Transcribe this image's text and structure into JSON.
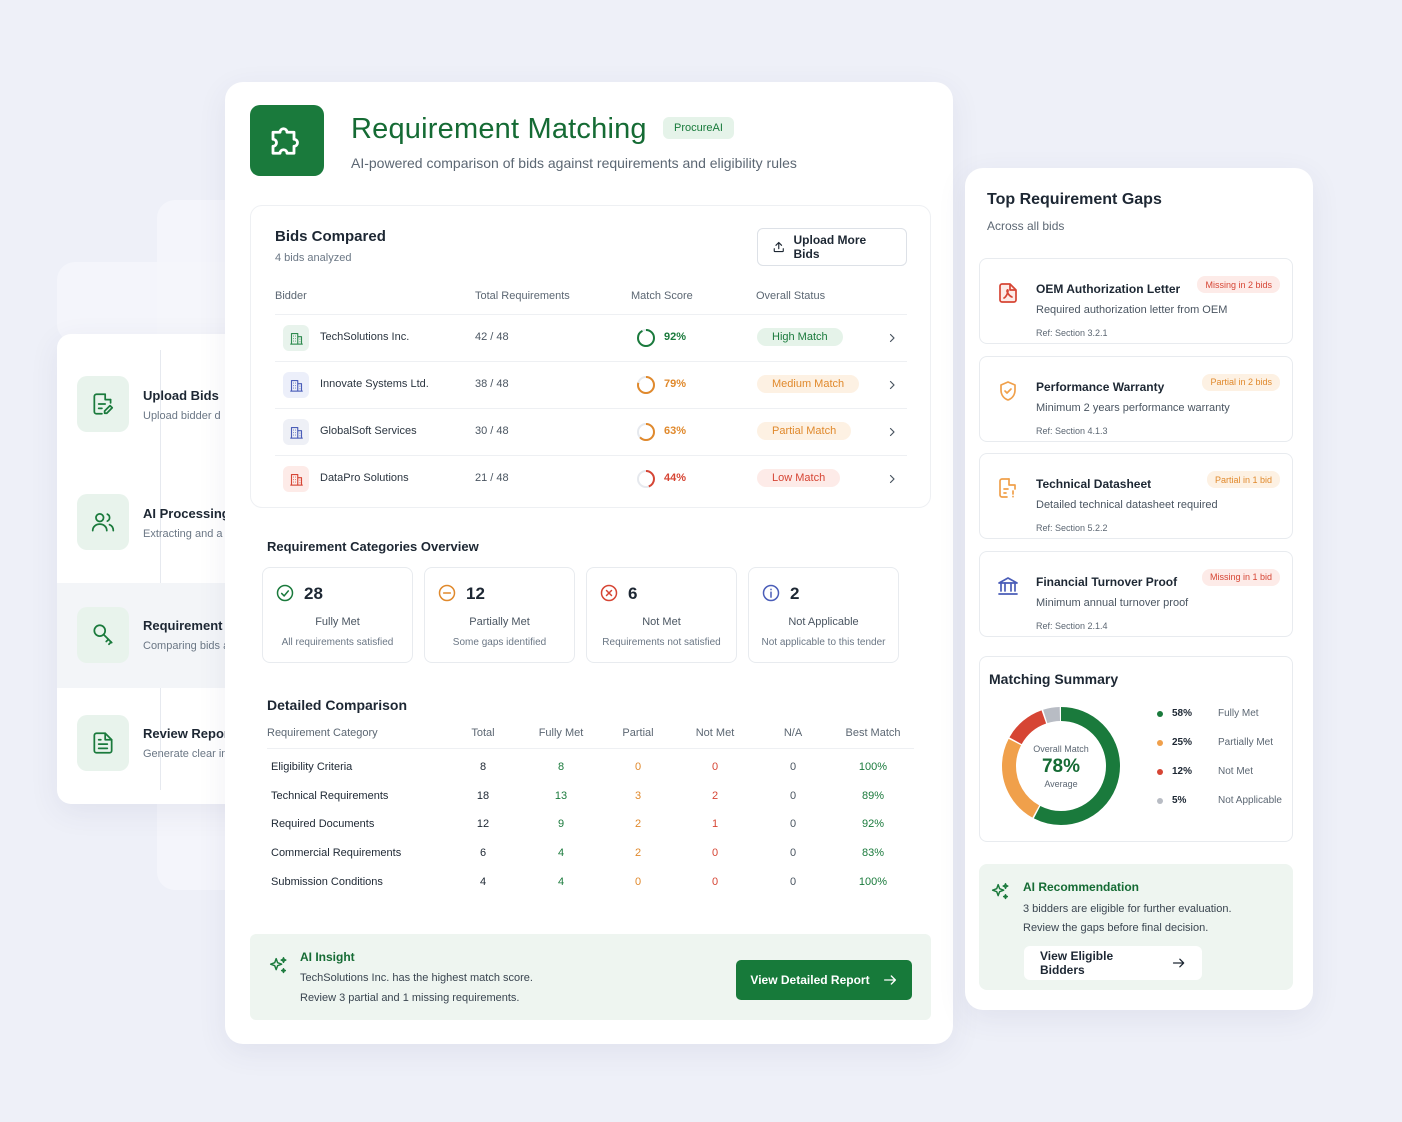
{
  "header": {
    "title": "Requirement Matching",
    "badge": "ProcureAI",
    "subtitle": "AI-powered comparison of bids against requirements and eligibility rules"
  },
  "workflow": {
    "steps": [
      {
        "title": "Upload Bids",
        "sub": "Upload bidder d",
        "icon": "document-edit-icon"
      },
      {
        "title": "AI Processing",
        "sub": "Extracting and a",
        "icon": "users-icon"
      },
      {
        "title": "Requirement M",
        "sub": "Comparing bids a",
        "icon": "match-search-icon"
      },
      {
        "title": "Review Report",
        "sub": "Generate clear in",
        "icon": "report-icon"
      }
    ]
  },
  "bids": {
    "title": "Bids Compared",
    "sub": "4 bids analyzed",
    "upload_label": "Upload More Bids",
    "columns": [
      "Bidder",
      "Total Requirements",
      "Match Score",
      "Overall Status"
    ],
    "rows": [
      {
        "name": "TechSolutions Inc.",
        "total": "42 / 48",
        "score": "92%",
        "score_value": 92,
        "status": "High Match",
        "color": "#1a7a3c",
        "bg": "#e5f3e9",
        "icon_color": "#2e8b4e",
        "icon_bg": "#e8f3ec"
      },
      {
        "name": "Innovate Systems Ltd.",
        "total": "38 / 48",
        "score": "79%",
        "score_value": 79,
        "status": "Medium Match",
        "color": "#e0892c",
        "bg": "#fdf1e3",
        "icon_color": "#4a5db8",
        "icon_bg": "#eceffa"
      },
      {
        "name": "GlobalSoft Services",
        "total": "30 / 48",
        "score": "63%",
        "score_value": 63,
        "status": "Partial Match",
        "color": "#e0892c",
        "bg": "#fdf1e3",
        "icon_color": "#4a5db8",
        "icon_bg": "#eef0f6"
      },
      {
        "name": "DataPro Solutions",
        "total": "21 / 48",
        "score": "44%",
        "score_value": 44,
        "status": "Low Match",
        "color": "#d64534",
        "bg": "#fdebe8",
        "icon_color": "#d64534",
        "icon_bg": "#fdebe8"
      }
    ]
  },
  "categories": {
    "title": "Requirement Categories Overview",
    "items": [
      {
        "count": "28",
        "label": "Fully Met",
        "desc": "All requirements satisfied",
        "icon": "check-circle-icon",
        "color": "#1a7a3c"
      },
      {
        "count": "12",
        "label": "Partially Met",
        "desc": "Some gaps identified",
        "icon": "minus-circle-icon",
        "color": "#e0892c"
      },
      {
        "count": "6",
        "label": "Not Met",
        "desc": "Requirements not satisfied",
        "icon": "x-circle-icon",
        "color": "#d64534"
      },
      {
        "count": "2",
        "label": "Not Applicable",
        "desc": "Not applicable to this tender",
        "icon": "info-circle-icon",
        "color": "#4a5db8"
      }
    ]
  },
  "detailed": {
    "title": "Detailed Comparison",
    "columns": [
      "Requirement Category",
      "Total",
      "Fully Met",
      "Partial",
      "Not Met",
      "N/A",
      "Best Match"
    ],
    "rows": [
      {
        "name": "Eligibility Criteria",
        "total": "8",
        "full": "8",
        "partial": "0",
        "not": "0",
        "na": "0",
        "best": "100%"
      },
      {
        "name": "Technical Requirements",
        "total": "18",
        "full": "13",
        "partial": "3",
        "not": "2",
        "na": "0",
        "best": "89%"
      },
      {
        "name": "Required Documents",
        "total": "12",
        "full": "9",
        "partial": "2",
        "not": "1",
        "na": "0",
        "best": "92%"
      },
      {
        "name": "Commercial Requirements",
        "total": "6",
        "full": "4",
        "partial": "2",
        "not": "0",
        "na": "0",
        "best": "83%"
      },
      {
        "name": "Submission Conditions",
        "total": "4",
        "full": "4",
        "partial": "0",
        "not": "0",
        "na": "0",
        "best": "100%"
      }
    ]
  },
  "insight": {
    "title": "AI Insight",
    "line1": "TechSolutions Inc. has the highest match score.",
    "line2": "Review 3 partial and 1 missing requirements.",
    "button": "View Detailed Report"
  },
  "gaps": {
    "title": "Top Requirement Gaps",
    "sub": "Across all bids",
    "items": [
      {
        "title": "OEM Authorization Letter",
        "badge": "Missing in 2 bids",
        "desc": "Required authorization letter from OEM",
        "ref": "Ref: Section 3.2.1",
        "icon": "pdf-file-icon",
        "badge_color": "#d64534",
        "badge_bg": "#fdebe8"
      },
      {
        "title": "Performance Warranty",
        "badge": "Partial in 2 bids",
        "desc": "Minimum 2 years performance warranty",
        "ref": "Ref: Section 4.1.3",
        "icon": "shield-check-icon",
        "badge_color": "#e0892c",
        "badge_bg": "#fdf1e3"
      },
      {
        "title": "Technical Datasheet",
        "badge": "Partial in 1 bid",
        "desc": "Detailed technical datasheet required",
        "ref": "Ref: Section 5.2.2",
        "icon": "document-warning-icon",
        "badge_color": "#e0892c",
        "badge_bg": "#fdf1e3"
      },
      {
        "title": "Financial Turnover Proof",
        "badge": "Missing in 1 bid",
        "desc": "Minimum annual turnover proof",
        "ref": "Ref: Section 2.1.4",
        "icon": "bank-icon",
        "badge_color": "#d64534",
        "badge_bg": "#fdebe8"
      }
    ]
  },
  "summary": {
    "title": "Matching Summary",
    "center_label": "Overall Match",
    "center_value": "78%",
    "center_sub": "Average",
    "segments": [
      {
        "pct": "58%",
        "value": 58,
        "name": "Fully Met",
        "color": "#1a7a3c"
      },
      {
        "pct": "25%",
        "value": 25,
        "name": "Partially Met",
        "color": "#f0a04b"
      },
      {
        "pct": "12%",
        "value": 12,
        "name": "Not Met",
        "color": "#d64534"
      },
      {
        "pct": "5%",
        "value": 5,
        "name": "Not Applicable",
        "color": "#b8bcc4"
      }
    ]
  },
  "recommendation": {
    "title": "AI Recommendation",
    "line1": "3 bidders are eligible for further evaluation.",
    "line2": "Review the gaps before final decision.",
    "button": "View Eligible Bidders"
  }
}
